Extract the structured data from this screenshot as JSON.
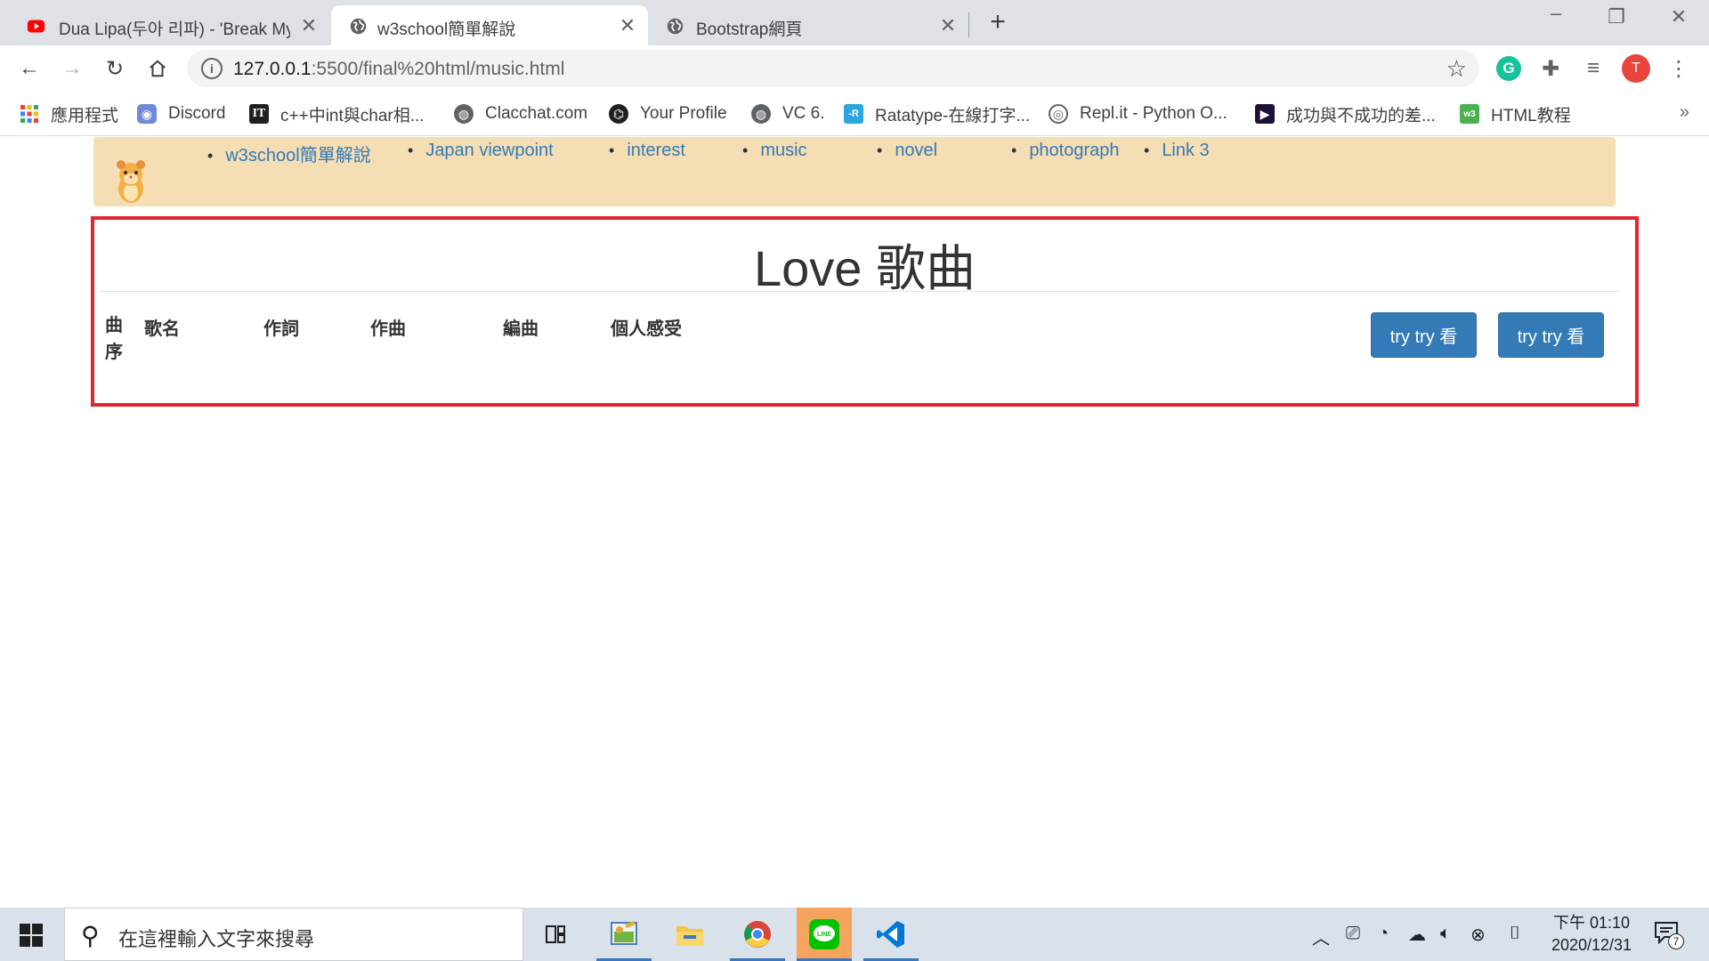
{
  "browser": {
    "tabs": [
      {
        "title": "Dua Lipa(두아 리파) - 'Break My",
        "icon": "youtube-icon",
        "active": false
      },
      {
        "title": "w3school簡單解說",
        "icon": "globe-icon",
        "active": true
      },
      {
        "title": "Bootstrap網頁",
        "icon": "globe-icon",
        "active": false
      }
    ],
    "new_tab_label": "+",
    "close_label": "✕",
    "url_host": "127.0.0.1",
    "url_path": ":5500/final%20html/music.html",
    "profile_initial": "T",
    "grammarly_initial": "G",
    "bookmarks": [
      {
        "label": "應用程式",
        "icon": "apps-grid-icon"
      },
      {
        "label": "Discord",
        "icon": "discord-icon"
      },
      {
        "label": "c++中int與char相...",
        "icon": "it-icon"
      },
      {
        "label": "Clacchat.com",
        "icon": "globe-icon"
      },
      {
        "label": "Your Profile",
        "icon": "github-icon"
      },
      {
        "label": "VC 6.",
        "icon": "globe-icon"
      },
      {
        "label": "Ratatype-在線打字...",
        "icon": "ratatype-icon"
      },
      {
        "label": "Repl.it - Python O...",
        "icon": "replit-icon"
      },
      {
        "label": "成功與不成功的差...",
        "icon": "play-icon"
      },
      {
        "label": "HTML教程",
        "icon": "w3-icon"
      }
    ],
    "bookmarks_more": "»"
  },
  "page": {
    "nav": [
      "w3school簡單解說",
      "Japan viewpoint",
      "interest",
      "music",
      "novel",
      "photograph",
      "Link 3"
    ],
    "heading": "Love 歌曲",
    "table_headers": [
      "曲序",
      "歌名",
      "作詞",
      "作曲",
      "編曲",
      "個人感受"
    ],
    "buttons": [
      "try try 看",
      "try try 看"
    ],
    "colors": {
      "navbar_bg": "#f5deb3",
      "link": "#337ab7",
      "panel_border": "#e02531",
      "button": "#337ab7"
    }
  },
  "taskbar": {
    "search_placeholder": "在這裡輸入文字來搜尋",
    "time": "下午 01:10",
    "date": "2020/12/31",
    "notification_count": "7"
  }
}
